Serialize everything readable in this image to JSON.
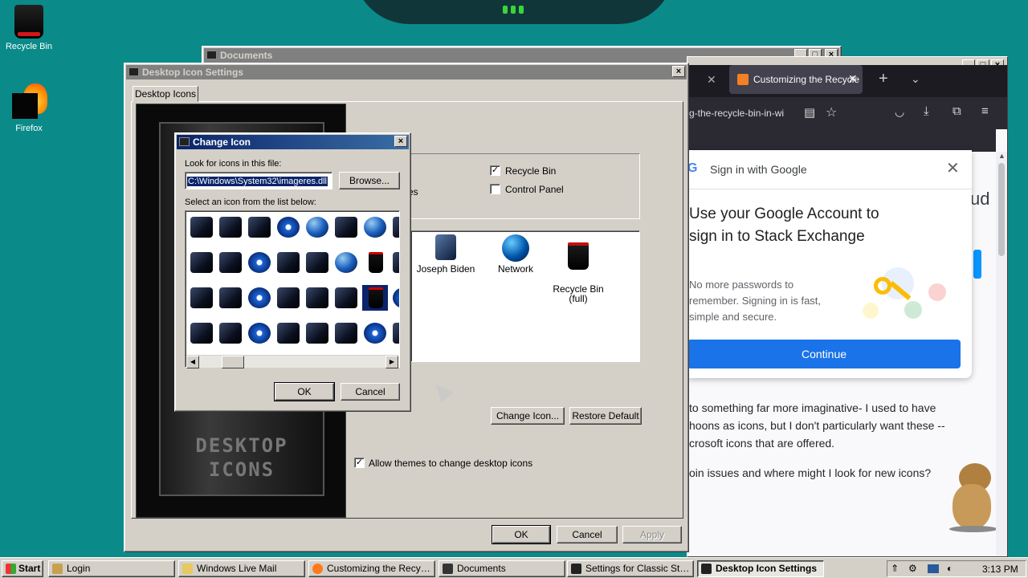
{
  "desktop": {
    "icons": [
      {
        "label": "Recycle Bin"
      },
      {
        "label": "Firefox"
      }
    ]
  },
  "documents_window": {
    "title": "Documents"
  },
  "browser": {
    "tab_label": "Customizing the Recycle",
    "url_fragment": "g-the-recycle-bin-in-wi",
    "google_popup": {
      "header": "Sign in with Google",
      "heading": "Use your Google Account to sign in to Stack Exchange",
      "body": "No more passwords to remember. Signing in is fast, simple and secure.",
      "continue_label": "Continue"
    },
    "side_fragment": "ud",
    "article_lines": [
      "to something far more imaginative- I used to have",
      "hoons as icons, but I don't particularly want these --",
      "crosoft icons that are offered."
    ],
    "article_question": "oin issues and where might I look for new icons?"
  },
  "settings_dialog": {
    "title": "Desktop Icon Settings",
    "tab": "Desktop Icons",
    "checkboxes": [
      {
        "label": "Recycle Bin",
        "checked": true
      },
      {
        "label": "Control Panel",
        "checked": false
      }
    ],
    "partial_text": "es",
    "icons": [
      {
        "label": "Joseph Biden"
      },
      {
        "label": "Network"
      },
      {
        "label": "Recycle Bin\n(full)"
      }
    ],
    "preview_text": [
      "DESKTOP",
      "ICONS"
    ],
    "change_icon_label": "Change Icon...",
    "restore_default_label": "Restore Default",
    "allow_themes_label": "Allow themes to change desktop icons",
    "allow_themes_checked": true,
    "ok_label": "OK",
    "cancel_label": "Cancel",
    "apply_label": "Apply"
  },
  "change_icon_dialog": {
    "title": "Change Icon",
    "look_label": "Look for icons in this file:",
    "file_value": "C:\\Windows\\System32\\imageres.dll",
    "browse_label": "Browse...",
    "select_label": "Select an icon from the list below:",
    "ok_label": "OK",
    "cancel_label": "Cancel"
  },
  "taskbar": {
    "start_label": "Start",
    "buttons": [
      {
        "label": "Login"
      },
      {
        "label": "Windows Live Mail"
      },
      {
        "label": "Customizing the Recycle ..."
      },
      {
        "label": "Documents"
      },
      {
        "label": "Settings for Classic Start..."
      },
      {
        "label": "Desktop Icon Settings"
      }
    ],
    "time": "3:13 PM"
  }
}
